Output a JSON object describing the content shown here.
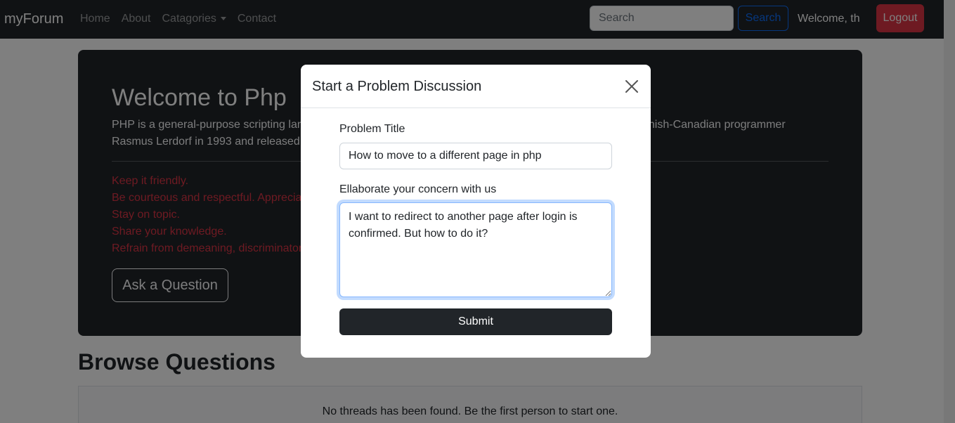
{
  "navbar": {
    "brand": "myForum",
    "links": [
      "Home",
      "About",
      "Catagories",
      "Contact"
    ],
    "search_placeholder": "Search",
    "search_button": "Search",
    "welcome": "Welcome, th",
    "logout": "Logout"
  },
  "hero": {
    "title": "Welcome to Php",
    "desc_line1_left": "PHP is a general-purpose scripting lan",
    "desc_line1_right": "anish-Canadian programmer",
    "desc_line2": "Rasmus Lerdorf in 1993 and released i",
    "rules": [
      "Keep it friendly.",
      "Be courteous and respectful. Apprecia",
      "Stay on topic.",
      "Share your knowledge.",
      "Refrain from demeaning, discriminator"
    ],
    "ask_button": "Ask a Question"
  },
  "browse": {
    "title": "Browse Questions",
    "empty_message": "No threads has been found. Be the first person to start one."
  },
  "modal": {
    "title": "Start a Problem Discussion",
    "problem_title_label": "Problem Title",
    "problem_title_value": "How to move to a different page in php",
    "concern_label": "Ellaborate your concern with us",
    "concern_value": "I want to redirect to another page after login is confirmed. But how to do it?",
    "submit": "Submit"
  },
  "colors": {
    "navbar_bg": "#212529",
    "danger": "#dc3545",
    "primary": "#0d6efd"
  }
}
